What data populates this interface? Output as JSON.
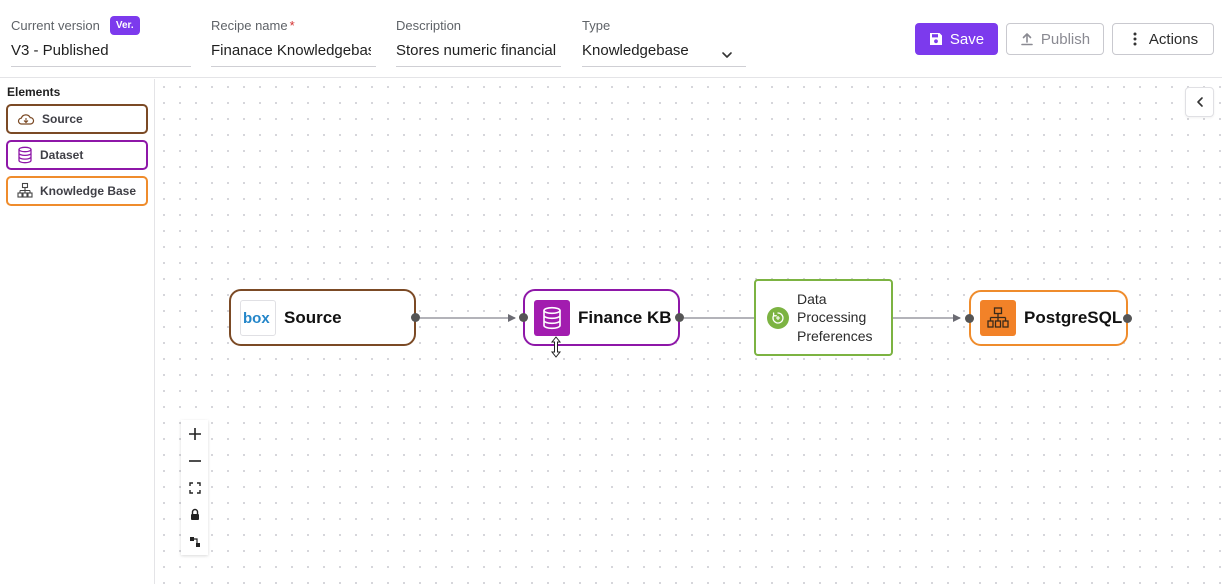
{
  "header": {
    "version_label": "Current version",
    "version_badge": "Ver.",
    "version_value": "V3 - Published",
    "recipe_label": "Recipe name",
    "recipe_required": "*",
    "recipe_value": "Finanace Knowledgebase",
    "description_label": "Description",
    "description_value": "Stores numeric financial data",
    "type_label": "Type",
    "type_value": "Knowledgebase",
    "save_label": "Save",
    "publish_label": "Publish",
    "actions_label": "Actions"
  },
  "sidebar": {
    "title": "Elements",
    "items": [
      {
        "label": "Source",
        "icon": "cloud-icon",
        "color": "#7b4a25"
      },
      {
        "label": "Dataset",
        "icon": "database-icon",
        "color": "#8e17a8"
      },
      {
        "label": "Knowledge Base",
        "icon": "knowledge-base-icon",
        "color": "#ef8c2c"
      }
    ]
  },
  "canvas": {
    "nodes": [
      {
        "id": "source",
        "title": "Source",
        "logo": "box",
        "icon": "box-logo-icon"
      },
      {
        "id": "finance-kb",
        "title": "Finance KB",
        "icon": "database-icon"
      },
      {
        "id": "dpp",
        "lines": [
          "Data",
          "Processing",
          "Preferences"
        ],
        "icon": "recycle-icon"
      },
      {
        "id": "postgres",
        "title": "PostgreSQL",
        "icon": "knowledge-base-icon"
      }
    ],
    "controls": [
      "zoom-in-icon",
      "zoom-out-icon",
      "fit-view-icon",
      "lock-icon",
      "layout-icon"
    ]
  },
  "colors": {
    "accent": "#7c3aed",
    "source": "#7b4a25",
    "dataset": "#8e17a8",
    "transform": "#7cb342",
    "knowledge_base": "#ef8c2c"
  }
}
